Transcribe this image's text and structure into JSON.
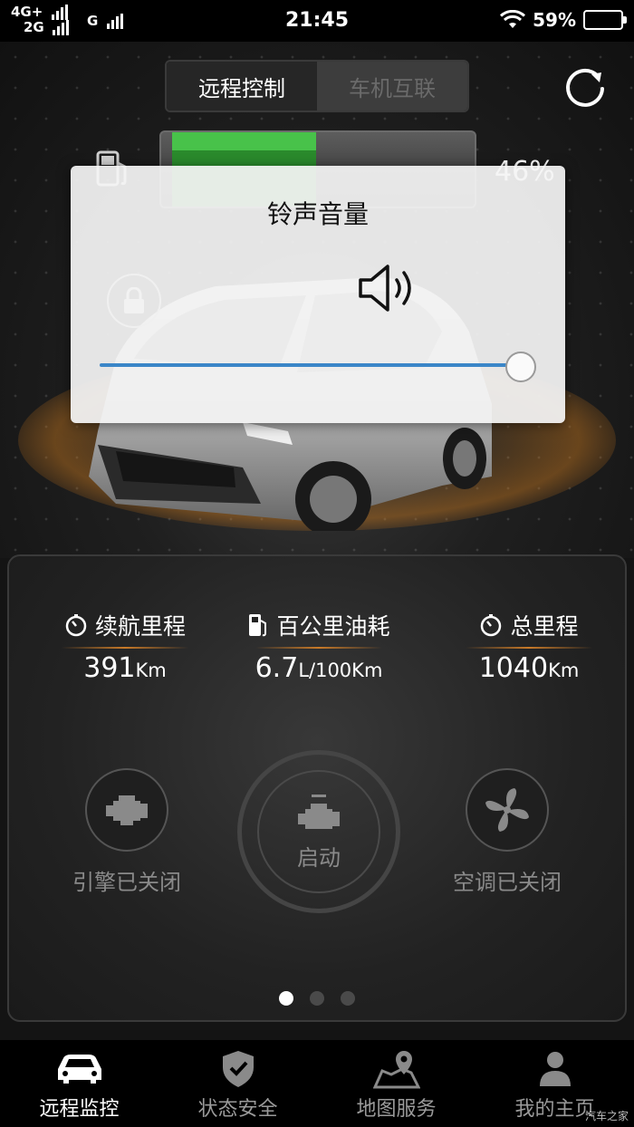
{
  "status_bar": {
    "net_top": "4G+",
    "net_bottom": "2G",
    "carrier2": "G",
    "time": "21:45",
    "battery_pct": "59%"
  },
  "segmented": {
    "tab_remote": "远程控制",
    "tab_connect": "车机互联"
  },
  "fuel": {
    "percent_label": "46%",
    "level": 0.46
  },
  "volume_dialog": {
    "title": "铃声音量",
    "level": 1.0
  },
  "stats": {
    "range": {
      "label": "续航里程",
      "value": "391",
      "unit": "Km"
    },
    "consumption": {
      "label": "百公里油耗",
      "value": "6.7",
      "unit": "L/100Km"
    },
    "odometer": {
      "label": "总里程",
      "value": "1040",
      "unit": "Km"
    }
  },
  "controls": {
    "engine": "引擎已关闭",
    "start": "启动",
    "ac": "空调已关闭"
  },
  "pager": {
    "current": 1,
    "total": 3
  },
  "bottom_nav": {
    "remote": "远程监控",
    "status": "状态安全",
    "map": "地图服务",
    "home": "我的主页"
  },
  "watermark": "汽车之家",
  "colors": {
    "fuel_green": "#48c24a",
    "slider_blue": "#3b86c8",
    "accent_orange": "#c97a28"
  }
}
